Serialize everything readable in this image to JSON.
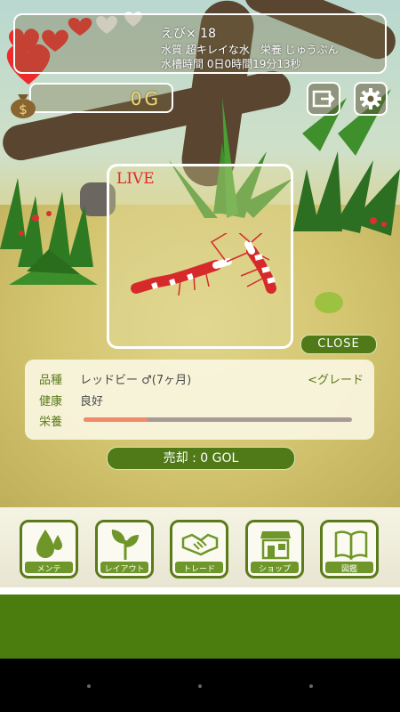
{
  "status": {
    "shrimp_count": "えび× 18",
    "water_quality": "水質 超キレイな水　栄養 じゅうぶん",
    "tank_time": "水槽時間 0日0時間19分13秒"
  },
  "money": {
    "amount": "0G"
  },
  "live": {
    "label": "LIVE"
  },
  "close_label": "CLOSE",
  "shrimp": {
    "species_label": "品種",
    "species_value": "レッドビー ♂(7ヶ月)",
    "grade_link": "<グレード",
    "health_label": "健康",
    "health_value": "良好",
    "nutrition_label": "栄養",
    "nutrition_level": 0.24
  },
  "sell_label": "売却 : 0 GOL",
  "nav": [
    {
      "label": "メンテ",
      "icon": "drops-icon"
    },
    {
      "label": "レイアウト",
      "icon": "plant-icon"
    },
    {
      "label": "トレード",
      "icon": "handshake-icon"
    },
    {
      "label": "ショップ",
      "icon": "shop-icon"
    },
    {
      "label": "図鑑",
      "icon": "book-icon"
    }
  ],
  "colors": {
    "accent_green": "#4f7a17",
    "live_red": "#e52828",
    "nutrition_fill": "#f08a6b"
  }
}
